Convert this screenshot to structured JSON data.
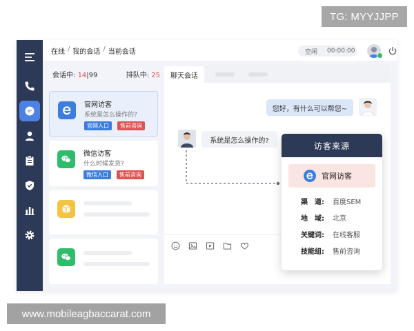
{
  "watermarks": {
    "top": "TG: MYYJJPP",
    "bottom": "www.mobileagbaccarat.com"
  },
  "topbar": {
    "breadcrumb": [
      "在线",
      "我的会话",
      "当前会话"
    ],
    "separator": "/",
    "status": "空闲",
    "timer": "00:00:00"
  },
  "counts": {
    "active_label": "会话中:",
    "active_value": "14",
    "active_sep": "|",
    "active_max": "99",
    "queue_label": "排队中:",
    "queue_value": "25"
  },
  "sessions": [
    {
      "title": "官网访客",
      "message": "系统是怎么操作的?",
      "tag_channel": "官网入口",
      "tag_type": "售前咨询"
    },
    {
      "title": "微信访客",
      "message": "什么时候发货?",
      "tag_channel": "微信入口",
      "tag_type": "售前咨询"
    }
  ],
  "chat": {
    "tab_label": "聊天会话",
    "agent_message": "您好，有什么可以帮您~",
    "visitor_message": "系统是怎么操作的?"
  },
  "visitor_source": {
    "title": "访客来源",
    "brand": "官网访客",
    "rows": [
      {
        "key": "渠　道:",
        "value": "百度SEM"
      },
      {
        "key": "地　域:",
        "value": "北京"
      },
      {
        "key": "关键词:",
        "value": "在线客服"
      },
      {
        "key": "技能组:",
        "value": "售前咨询"
      }
    ]
  },
  "colors": {
    "sidebar": "#2c3a57",
    "accent": "#4d82e5",
    "tag_blue": "#3d7de0",
    "tag_red": "#e05252",
    "wechat_green": "#2fbd6b",
    "package_yellow": "#f5c343"
  }
}
